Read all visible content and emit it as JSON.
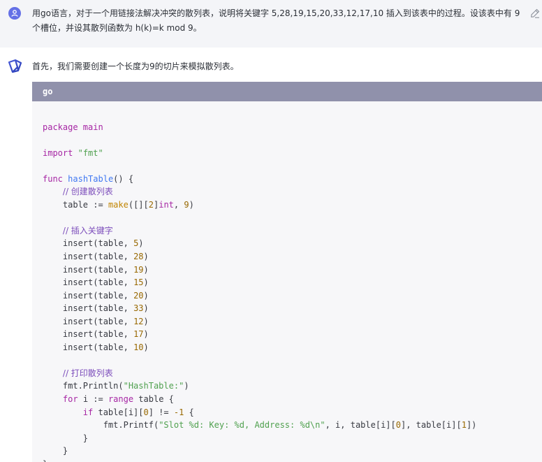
{
  "user": {
    "message": "用go语言，对于一个用链接法解决冲突的散列表，说明将关键字 5,28,19,15,20,33,12,17,10 插入到该表中的过程。设该表中有 9 个槽位，并设其散列函数为 h(k)=k mod 9。"
  },
  "assistant": {
    "intro": "首先，我们需要创建一个长度为9的切片来模拟散列表。"
  },
  "code_block": {
    "language": "go",
    "lines": {
      "l1": "package main",
      "l3a": "import",
      "l3b": "\"fmt\"",
      "l5a": "func",
      "l5b": "hashTable",
      "l5c": "() {",
      "l6": "// 创建散列表",
      "l7a": "table := ",
      "l7b": "make",
      "l7c": "([][",
      "l7d": "2",
      "l7e": "]",
      "l7f": "int",
      "l7g": ", ",
      "l7h": "9",
      "l7i": ")",
      "l9": "// 插入关键字",
      "inserts": [
        "5",
        "28",
        "19",
        "15",
        "20",
        "33",
        "12",
        "17",
        "10"
      ],
      "insert_prefix": "insert(table, ",
      "insert_suffix": ")",
      "l20": "// 打印散列表",
      "l21a": "fmt.Println(",
      "l21b": "\"HashTable:\"",
      "l21c": ")",
      "l22a": "for",
      "l22b": " i := ",
      "l22c": "range",
      "l22d": " table {",
      "l23a": "if",
      "l23b": " table[i][",
      "l23c": "0",
      "l23d": "] != ",
      "l23e": "-1",
      "l23f": " {",
      "l24a": "fmt.Printf(",
      "l24b": "\"Slot %d: Key: %d, Address: %d\\n\"",
      "l24c": ", i, table[i][",
      "l24d": "0",
      "l24e": "], table[i][",
      "l24f": "1",
      "l24g": "])",
      "close": "}"
    }
  }
}
